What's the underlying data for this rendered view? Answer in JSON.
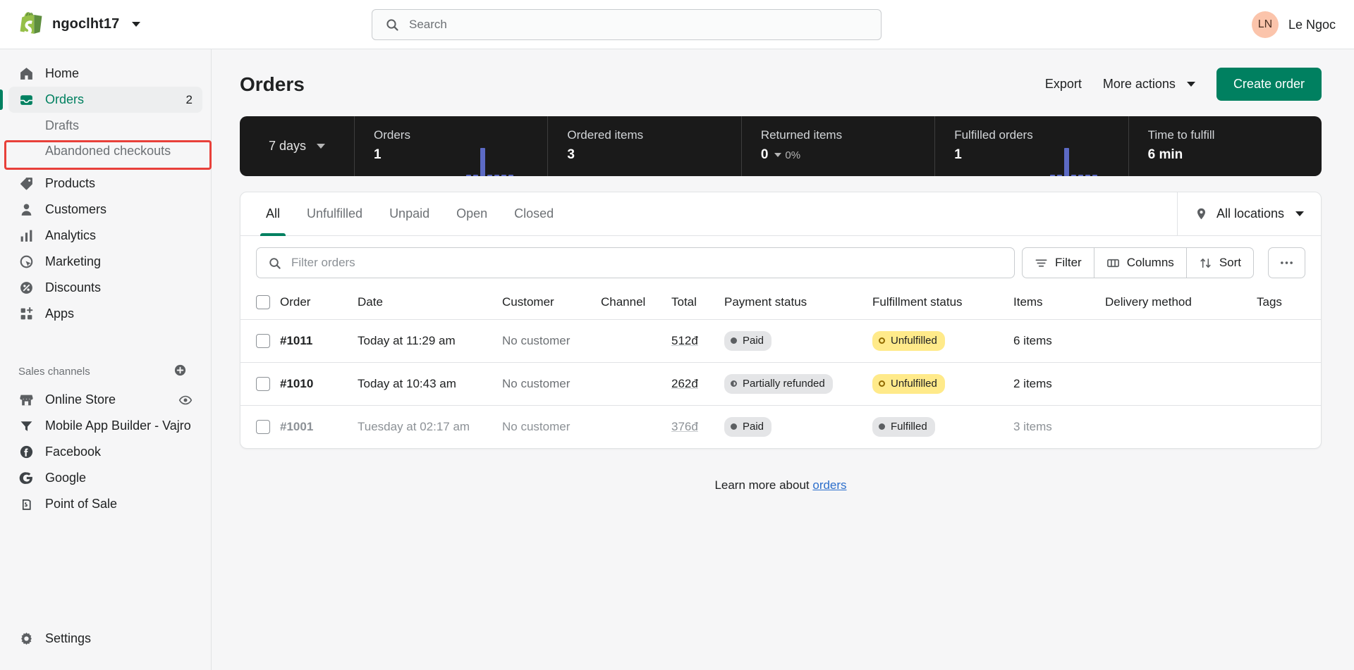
{
  "topbar": {
    "store_name": "ngoclht17",
    "logo_icon": "shopify-logo",
    "store_chevron_icon": "chevron-down-icon",
    "search_icon": "search-icon",
    "search_placeholder": "Search",
    "search_value": "",
    "avatar_initials": "LN",
    "user_name": "Le Ngoc"
  },
  "sidebar": {
    "items": [
      {
        "label": "Home",
        "icon": "home-icon",
        "badge": "",
        "active": false
      },
      {
        "label": "Orders",
        "icon": "orders-icon",
        "badge": "2",
        "active": true
      },
      {
        "label": "Drafts",
        "icon": "",
        "badge": "",
        "sub": true
      },
      {
        "label": "Abandoned checkouts",
        "icon": "",
        "badge": "",
        "sub": true
      },
      {
        "label": "Products",
        "icon": "products-tag-icon",
        "badge": "",
        "active": false
      },
      {
        "label": "Customers",
        "icon": "customers-icon",
        "badge": "",
        "active": false
      },
      {
        "label": "Analytics",
        "icon": "analytics-bars-icon",
        "badge": "",
        "active": false
      },
      {
        "label": "Marketing",
        "icon": "marketing-target-icon",
        "badge": "",
        "active": false
      },
      {
        "label": "Discounts",
        "icon": "discounts-percent-icon",
        "badge": "",
        "active": false
      },
      {
        "label": "Apps",
        "icon": "apps-grid-icon",
        "badge": "",
        "active": false
      }
    ],
    "sales_channels_label": "Sales channels",
    "add_channel_icon": "plus-circle-icon",
    "channels": [
      {
        "label": "Online Store",
        "icon": "storefront-icon",
        "trailing_icon": "eye-icon"
      },
      {
        "label": "Mobile App Builder - Vajro",
        "icon": "vajro-funnel-icon",
        "trailing_icon": ""
      },
      {
        "label": "Facebook",
        "icon": "facebook-icon",
        "trailing_icon": ""
      },
      {
        "label": "Google",
        "icon": "google-icon",
        "trailing_icon": ""
      },
      {
        "label": "Point of Sale",
        "icon": "point-of-sale-icon",
        "trailing_icon": ""
      }
    ],
    "settings": {
      "label": "Settings",
      "icon": "gear-icon"
    }
  },
  "page": {
    "title": "Orders",
    "export_label": "Export",
    "more_actions_label": "More actions",
    "more_actions_chevron": "chevron-down-icon",
    "create_order_label": "Create order"
  },
  "metrics": {
    "range_label": "7 days",
    "range_chevron": "chevron-down-icon",
    "cells": [
      {
        "label": "Orders",
        "value": "1",
        "delta": "",
        "delta_icon": ""
      },
      {
        "label": "Ordered items",
        "value": "3",
        "delta": "",
        "delta_icon": ""
      },
      {
        "label": "Returned items",
        "value": "0",
        "delta": "0%",
        "delta_icon": "caret-down-icon"
      },
      {
        "label": "Fulfilled orders",
        "value": "1",
        "delta": "",
        "delta_icon": ""
      },
      {
        "label": "Time to fulfill",
        "value": "6 min",
        "delta": "",
        "delta_icon": ""
      }
    ],
    "spark_color": "#5c6ac4"
  },
  "tabs": [
    {
      "label": "All",
      "active": true
    },
    {
      "label": "Unfulfilled",
      "active": false
    },
    {
      "label": "Unpaid",
      "active": false
    },
    {
      "label": "Open",
      "active": false
    },
    {
      "label": "Closed",
      "active": false
    }
  ],
  "locations": {
    "label": "All locations",
    "icon": "location-pin-icon",
    "chevron": "chevron-down-icon"
  },
  "toolbar": {
    "filter_placeholder": "Filter orders",
    "filter_value": "",
    "search_icon": "search-icon",
    "filter_label": "Filter",
    "filter_icon": "filter-lines-icon",
    "columns_label": "Columns",
    "columns_icon": "columns-icon",
    "sort_label": "Sort",
    "sort_icon": "sort-arrows-icon",
    "more_icon": "ellipsis-icon"
  },
  "table": {
    "columns": [
      "Order",
      "Date",
      "Customer",
      "Channel",
      "Total",
      "Payment status",
      "Fulfillment status",
      "Items",
      "Delivery method",
      "Tags"
    ],
    "rows": [
      {
        "order": "#1011",
        "date": "Today at 11:29 am",
        "customer": "No customer",
        "channel": "",
        "total": "512đ",
        "payment_status": "Paid",
        "payment_badge": "gray",
        "payment_dot": "dark",
        "fulfillment_status": "Unfulfilled",
        "fulfillment_badge": "yellow",
        "fulfillment_dot": "ring-y",
        "items": "6 items",
        "delivery_method": "",
        "tags": "",
        "dimmed": false
      },
      {
        "order": "#1010",
        "date": "Today at 10:43 am",
        "customer": "No customer",
        "channel": "",
        "total": "262đ",
        "payment_status": "Partially refunded",
        "payment_badge": "gray",
        "payment_dot": "half",
        "fulfillment_status": "Unfulfilled",
        "fulfillment_badge": "yellow",
        "fulfillment_dot": "ring-y",
        "items": "2 items",
        "delivery_method": "",
        "tags": "",
        "dimmed": false
      },
      {
        "order": "#1001",
        "date": "Tuesday at 02:17 am",
        "customer": "No customer",
        "channel": "",
        "total": "376đ",
        "payment_status": "Paid",
        "payment_badge": "gray",
        "payment_dot": "dark",
        "fulfillment_status": "Fulfilled",
        "fulfillment_badge": "gray",
        "fulfillment_dot": "dark",
        "items": "3 items",
        "delivery_method": "",
        "tags": "",
        "dimmed": true
      }
    ]
  },
  "footer": {
    "text": "Learn more about ",
    "link": "orders"
  },
  "colors": {
    "brand_green": "#008060",
    "accent_blue": "#5c6ac4",
    "badge_yellow": "#ffea8a",
    "annotation_red": "#e8403a"
  }
}
